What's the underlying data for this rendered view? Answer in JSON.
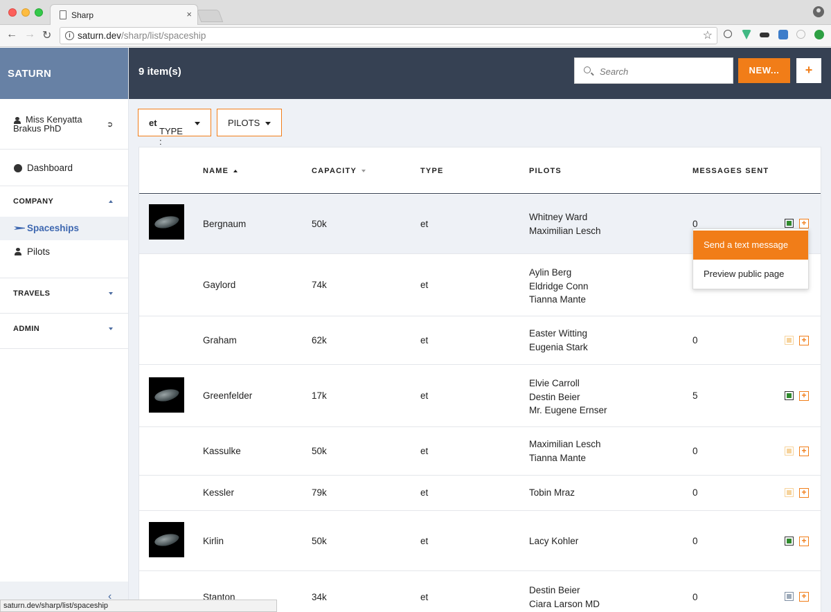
{
  "browser": {
    "tab_title": "Sharp",
    "tab_close": "×",
    "url_host": "saturn.dev",
    "url_path": "/sharp/list/spaceship",
    "status_url": "saturn.dev/sharp/list/spaceship"
  },
  "sidebar": {
    "brand": "SATURN",
    "user_name": "Miss Kenyatta Brakus PhD",
    "dashboard_label": "Dashboard",
    "groups": [
      {
        "title": "COMPANY",
        "items": [
          "Spaceships",
          "Pilots"
        ]
      },
      {
        "title": "TRAVELS"
      },
      {
        "title": "ADMIN"
      }
    ]
  },
  "header": {
    "item_count": "9 item(s)",
    "search_placeholder": "Search",
    "new_label": "NEW...",
    "plus_label": "+"
  },
  "filters": {
    "type_label": "TYPE : ",
    "type_value": "et",
    "pilots_label": "PILOTS"
  },
  "table": {
    "columns": [
      "NAME",
      "CAPACITY",
      "TYPE",
      "PILOTS",
      "MESSAGES SENT"
    ],
    "rows": [
      {
        "name": "Bergnaum",
        "capacity": "50k",
        "type": "et",
        "pilots": [
          "Whitney Ward",
          "Maximilian Lesch"
        ],
        "messages": "0",
        "state": "on",
        "has_image": true
      },
      {
        "name": "Gaylord",
        "capacity": "74k",
        "type": "et",
        "pilots": [
          "Aylin Berg",
          "Eldridge Conn",
          "Tianna Mante"
        ],
        "messages": "",
        "state": "pending",
        "has_image": false
      },
      {
        "name": "Graham",
        "capacity": "62k",
        "type": "et",
        "pilots": [
          "Easter Witting",
          "Eugenia Stark"
        ],
        "messages": "0",
        "state": "pending",
        "has_image": false
      },
      {
        "name": "Greenfelder",
        "capacity": "17k",
        "type": "et",
        "pilots": [
          "Elvie Carroll",
          "Destin Beier",
          "Mr. Eugene Ernser"
        ],
        "messages": "5",
        "state": "on",
        "has_image": true
      },
      {
        "name": "Kassulke",
        "capacity": "50k",
        "type": "et",
        "pilots": [
          "Maximilian Lesch",
          "Tianna Mante"
        ],
        "messages": "0",
        "state": "pending",
        "has_image": false
      },
      {
        "name": "Kessler",
        "capacity": "79k",
        "type": "et",
        "pilots": [
          "Tobin Mraz"
        ],
        "messages": "0",
        "state": "pending",
        "has_image": false
      },
      {
        "name": "Kirlin",
        "capacity": "50k",
        "type": "et",
        "pilots": [
          "Lacy Kohler"
        ],
        "messages": "0",
        "state": "on",
        "has_image": true
      },
      {
        "name": "Stanton",
        "capacity": "34k",
        "type": "et",
        "pilots": [
          "Destin Beier",
          "Ciara Larson MD"
        ],
        "messages": "0",
        "state": "grey",
        "has_image": false
      }
    ]
  },
  "dropdown": {
    "items": [
      "Send a text message",
      "Preview public page"
    ]
  },
  "colors": {
    "brand_bg": "#6781a5",
    "topbar_bg": "#364153",
    "accent": "#f17d18",
    "active_nav": "#3d67b0",
    "state_on": "#2f8a2c",
    "state_pending": "#f6d39c"
  },
  "icons": [
    "page-icon",
    "info-icon",
    "star-icon",
    "user-icon",
    "logout-icon",
    "dashboard-icon",
    "spaceship-icon",
    "pilot-icon",
    "search-icon",
    "collapse-chevron-icon"
  ]
}
